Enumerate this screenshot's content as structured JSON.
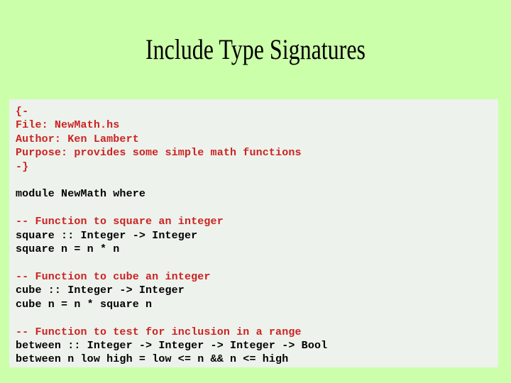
{
  "slide": {
    "title": "Include Type Signatures",
    "background_color": "#ccffaa",
    "panel_color": "#edf2ec",
    "comment_color": "#cc2222",
    "code_color": "#000000"
  },
  "code": {
    "language": "Haskell",
    "lines": [
      {
        "text": "{-",
        "kind": "comment"
      },
      {
        "text": "File: NewMath.hs",
        "kind": "comment"
      },
      {
        "text": "Author: Ken Lambert",
        "kind": "comment"
      },
      {
        "text": "Purpose: provides some simple math functions",
        "kind": "comment"
      },
      {
        "text": "-}",
        "kind": "comment"
      },
      {
        "text": "",
        "kind": "blank"
      },
      {
        "text": "module NewMath where",
        "kind": "code"
      },
      {
        "text": "",
        "kind": "blank"
      },
      {
        "text": "-- Function to square an integer",
        "kind": "comment"
      },
      {
        "text": "square :: Integer -> Integer",
        "kind": "code"
      },
      {
        "text": "square n = n * n",
        "kind": "code"
      },
      {
        "text": "",
        "kind": "blank"
      },
      {
        "text": "-- Function to cube an integer",
        "kind": "comment"
      },
      {
        "text": "cube :: Integer -> Integer",
        "kind": "code"
      },
      {
        "text": "cube n = n * square n",
        "kind": "code"
      },
      {
        "text": "",
        "kind": "blank"
      },
      {
        "text": "-- Function to test for inclusion in a range",
        "kind": "comment"
      },
      {
        "text": "between :: Integer -> Integer -> Integer -> Bool",
        "kind": "code"
      },
      {
        "text": "between n low high = low <= n && n <= high",
        "kind": "code"
      }
    ]
  }
}
